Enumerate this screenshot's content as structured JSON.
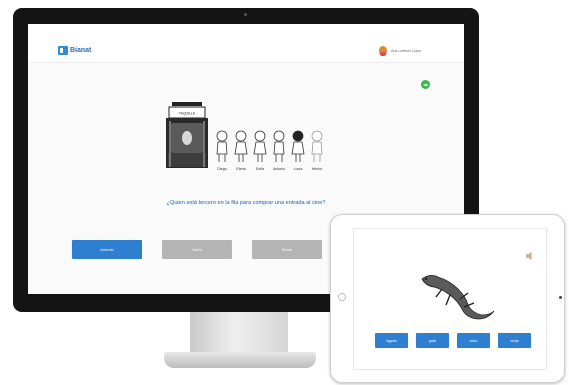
{
  "desktop": {
    "app": {
      "logo_text": "Bianat",
      "user_name": "Ana Lorenzo López",
      "question": "¿Quien está tercero en la fila para comprar una entrada al cine?",
      "cinema_sign": "TAQUILLA",
      "characters": [
        "Diego",
        "Elena",
        "Sofía",
        "Antonio",
        "Lucía",
        "Héctor"
      ],
      "answers": [
        {
          "label": "Antonio",
          "style": "primary"
        },
        {
          "label": "Sofía",
          "style": "grey"
        },
        {
          "label": "Elena",
          "style": "grey"
        }
      ],
      "colors": {
        "accent": "#2e7fd0",
        "inactive": "#b4b4b4",
        "sound": "#33b54a"
      }
    }
  },
  "tablet": {
    "answers": [
      "lagarto",
      "gallo",
      "ratón",
      "oveja"
    ],
    "icons": {
      "sound": "speaker-icon",
      "image": "lizard-illustration"
    }
  }
}
